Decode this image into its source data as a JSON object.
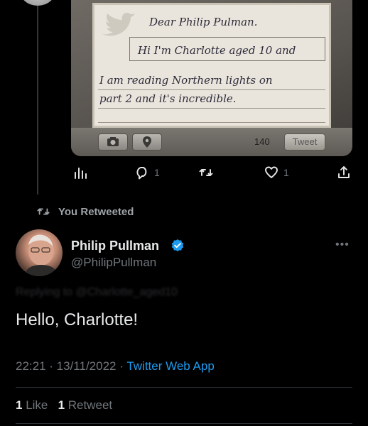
{
  "quoted_tweet": {
    "note_lines": [
      "Dear Philip Pulman.",
      "Hi I'm Charlotte aged 10 and",
      "I am reading Northern lights on",
      "part 2 and it's incredible."
    ],
    "char_count": "140",
    "tweet_button_label": "Tweet",
    "reply_count": "1",
    "like_count": "1"
  },
  "retweet_banner": {
    "label": "You Retweeted"
  },
  "tweet": {
    "author_name": "Philip Pullman",
    "author_handle": "@PhilipPullman",
    "verified": true,
    "more_label": "•••",
    "replying_to": "Replying to @Charlotte_aged10",
    "text": "Hello, Charlotte!",
    "time": "22:21",
    "date": "13/11/2022",
    "source": "Twitter Web App",
    "like_count": "1",
    "like_label": "Like",
    "retweet_count": "1",
    "retweet_label": "Retweet"
  },
  "colors": {
    "background": "#000000",
    "link": "#1d9bf0",
    "muted": "#71767b",
    "verified": "#1d9bf0"
  }
}
